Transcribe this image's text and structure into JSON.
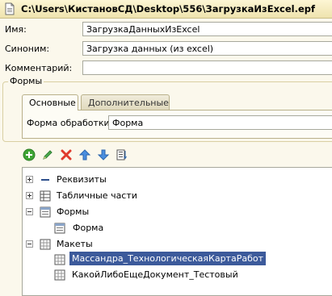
{
  "window": {
    "title": "C:\\Users\\КистановСД\\Desktop\\556\\ЗагрузкаИзExcel.epf"
  },
  "form": {
    "name_label": "Имя:",
    "name_value": "ЗагрузкаДанныхИзExcel",
    "synonym_label": "Синоним:",
    "synonym_value": "Загрузка данных (из excel)",
    "comment_label": "Комментарий:",
    "comment_value": ""
  },
  "forms_group": {
    "title": "Формы",
    "tabs": [
      {
        "label": "Основные"
      },
      {
        "label": "Дополнительные"
      }
    ],
    "processing_form_label": "Форма обработки:",
    "processing_form_value": "Форма"
  },
  "toolbar": {
    "buttons": [
      "add-icon",
      "edit-icon",
      "delete-icon",
      "move-up-icon",
      "move-down-icon",
      "sort-icon"
    ]
  },
  "tree": {
    "items": [
      {
        "label": "Реквизиты"
      },
      {
        "label": "Табличные части"
      },
      {
        "label": "Формы"
      },
      {
        "label": "Форма"
      },
      {
        "label": "Макеты"
      },
      {
        "label": "Массандра_ТехнологическаяКартаРабот"
      },
      {
        "label": "КакойЛибоЕщеДокумент_Тестовый"
      }
    ]
  },
  "colors": {
    "background": "#fbf8ec",
    "selection": "#3c5a9b",
    "titlebar": "#f4ecc1"
  }
}
